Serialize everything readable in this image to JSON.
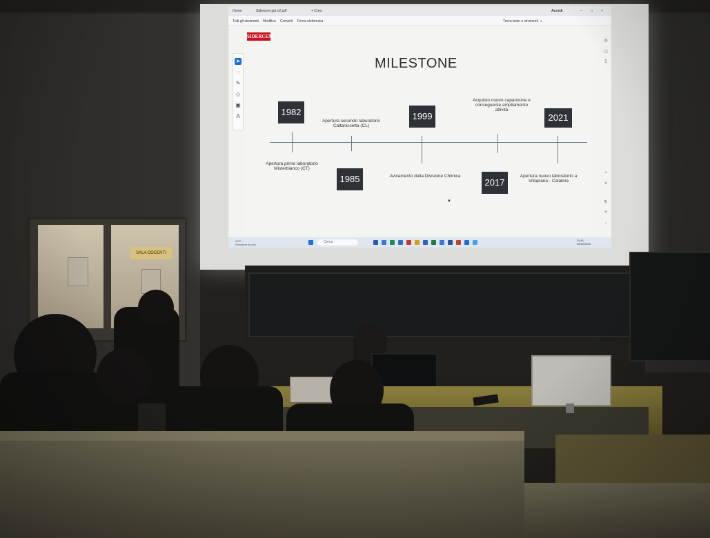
{
  "app": {
    "tab1": "Home",
    "tab2": "Sidercem ppt v2.pdf",
    "tab3": "+ Crea",
    "accedi": "Accedi"
  },
  "menu": {
    "items": [
      "Tutti gli strumenti",
      "Modifica",
      "Converti",
      "Firma elettronica"
    ],
    "search": "Trova testo e strumenti"
  },
  "slide": {
    "logo": "SIDERCEM",
    "title": "MILESTONE",
    "milestones": [
      {
        "year": "1982",
        "caption": "Apertura primo laboratorio Misterbianco (CT)"
      },
      {
        "year": "1985",
        "caption": "Apertura secondo laboratorio Caltanissetta (CL)"
      },
      {
        "year": "1999",
        "caption": "Avviamento della Divisione Chimica"
      },
      {
        "year": "2017",
        "caption": "Acquisto nuovo capannone e conseguente ampliamento attività"
      },
      {
        "year": "2021",
        "caption": "Apertura nuovo laboratorio a Villapiana - Calabria"
      }
    ]
  },
  "taskbar": {
    "search": "Cerca",
    "weather_temp": "10°C",
    "weather_desc": "Prevalent nuvolo",
    "time": "15:41",
    "date": "30/10/2024"
  },
  "door_sign": "SALA DOCENTI",
  "colors": {
    "year_box": "#2e3236",
    "logo_red": "#c8101e",
    "timeline": "#6d7a85"
  }
}
